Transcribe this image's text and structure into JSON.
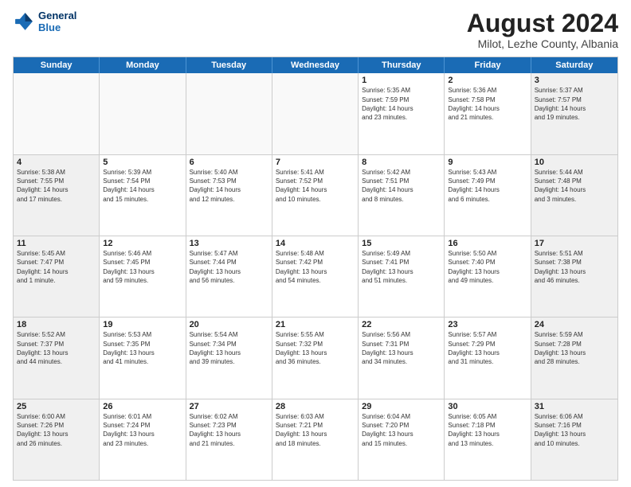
{
  "header": {
    "logo_line1": "General",
    "logo_line2": "Blue",
    "month_year": "August 2024",
    "location": "Milot, Lezhe County, Albania"
  },
  "weekdays": [
    "Sunday",
    "Monday",
    "Tuesday",
    "Wednesday",
    "Thursday",
    "Friday",
    "Saturday"
  ],
  "rows": [
    [
      {
        "day": "",
        "empty": true,
        "lines": []
      },
      {
        "day": "",
        "empty": true,
        "lines": []
      },
      {
        "day": "",
        "empty": true,
        "lines": []
      },
      {
        "day": "",
        "empty": true,
        "lines": []
      },
      {
        "day": "1",
        "lines": [
          "Sunrise: 5:35 AM",
          "Sunset: 7:59 PM",
          "Daylight: 14 hours",
          "and 23 minutes."
        ]
      },
      {
        "day": "2",
        "lines": [
          "Sunrise: 5:36 AM",
          "Sunset: 7:58 PM",
          "Daylight: 14 hours",
          "and 21 minutes."
        ]
      },
      {
        "day": "3",
        "shaded": true,
        "lines": [
          "Sunrise: 5:37 AM",
          "Sunset: 7:57 PM",
          "Daylight: 14 hours",
          "and 19 minutes."
        ]
      }
    ],
    [
      {
        "day": "4",
        "shaded": true,
        "lines": [
          "Sunrise: 5:38 AM",
          "Sunset: 7:55 PM",
          "Daylight: 14 hours",
          "and 17 minutes."
        ]
      },
      {
        "day": "5",
        "lines": [
          "Sunrise: 5:39 AM",
          "Sunset: 7:54 PM",
          "Daylight: 14 hours",
          "and 15 minutes."
        ]
      },
      {
        "day": "6",
        "lines": [
          "Sunrise: 5:40 AM",
          "Sunset: 7:53 PM",
          "Daylight: 14 hours",
          "and 12 minutes."
        ]
      },
      {
        "day": "7",
        "lines": [
          "Sunrise: 5:41 AM",
          "Sunset: 7:52 PM",
          "Daylight: 14 hours",
          "and 10 minutes."
        ]
      },
      {
        "day": "8",
        "lines": [
          "Sunrise: 5:42 AM",
          "Sunset: 7:51 PM",
          "Daylight: 14 hours",
          "and 8 minutes."
        ]
      },
      {
        "day": "9",
        "lines": [
          "Sunrise: 5:43 AM",
          "Sunset: 7:49 PM",
          "Daylight: 14 hours",
          "and 6 minutes."
        ]
      },
      {
        "day": "10",
        "shaded": true,
        "lines": [
          "Sunrise: 5:44 AM",
          "Sunset: 7:48 PM",
          "Daylight: 14 hours",
          "and 3 minutes."
        ]
      }
    ],
    [
      {
        "day": "11",
        "shaded": true,
        "lines": [
          "Sunrise: 5:45 AM",
          "Sunset: 7:47 PM",
          "Daylight: 14 hours",
          "and 1 minute."
        ]
      },
      {
        "day": "12",
        "lines": [
          "Sunrise: 5:46 AM",
          "Sunset: 7:45 PM",
          "Daylight: 13 hours",
          "and 59 minutes."
        ]
      },
      {
        "day": "13",
        "lines": [
          "Sunrise: 5:47 AM",
          "Sunset: 7:44 PM",
          "Daylight: 13 hours",
          "and 56 minutes."
        ]
      },
      {
        "day": "14",
        "lines": [
          "Sunrise: 5:48 AM",
          "Sunset: 7:42 PM",
          "Daylight: 13 hours",
          "and 54 minutes."
        ]
      },
      {
        "day": "15",
        "lines": [
          "Sunrise: 5:49 AM",
          "Sunset: 7:41 PM",
          "Daylight: 13 hours",
          "and 51 minutes."
        ]
      },
      {
        "day": "16",
        "lines": [
          "Sunrise: 5:50 AM",
          "Sunset: 7:40 PM",
          "Daylight: 13 hours",
          "and 49 minutes."
        ]
      },
      {
        "day": "17",
        "shaded": true,
        "lines": [
          "Sunrise: 5:51 AM",
          "Sunset: 7:38 PM",
          "Daylight: 13 hours",
          "and 46 minutes."
        ]
      }
    ],
    [
      {
        "day": "18",
        "shaded": true,
        "lines": [
          "Sunrise: 5:52 AM",
          "Sunset: 7:37 PM",
          "Daylight: 13 hours",
          "and 44 minutes."
        ]
      },
      {
        "day": "19",
        "lines": [
          "Sunrise: 5:53 AM",
          "Sunset: 7:35 PM",
          "Daylight: 13 hours",
          "and 41 minutes."
        ]
      },
      {
        "day": "20",
        "lines": [
          "Sunrise: 5:54 AM",
          "Sunset: 7:34 PM",
          "Daylight: 13 hours",
          "and 39 minutes."
        ]
      },
      {
        "day": "21",
        "lines": [
          "Sunrise: 5:55 AM",
          "Sunset: 7:32 PM",
          "Daylight: 13 hours",
          "and 36 minutes."
        ]
      },
      {
        "day": "22",
        "lines": [
          "Sunrise: 5:56 AM",
          "Sunset: 7:31 PM",
          "Daylight: 13 hours",
          "and 34 minutes."
        ]
      },
      {
        "day": "23",
        "lines": [
          "Sunrise: 5:57 AM",
          "Sunset: 7:29 PM",
          "Daylight: 13 hours",
          "and 31 minutes."
        ]
      },
      {
        "day": "24",
        "shaded": true,
        "lines": [
          "Sunrise: 5:59 AM",
          "Sunset: 7:28 PM",
          "Daylight: 13 hours",
          "and 28 minutes."
        ]
      }
    ],
    [
      {
        "day": "25",
        "shaded": true,
        "lines": [
          "Sunrise: 6:00 AM",
          "Sunset: 7:26 PM",
          "Daylight: 13 hours",
          "and 26 minutes."
        ]
      },
      {
        "day": "26",
        "lines": [
          "Sunrise: 6:01 AM",
          "Sunset: 7:24 PM",
          "Daylight: 13 hours",
          "and 23 minutes."
        ]
      },
      {
        "day": "27",
        "lines": [
          "Sunrise: 6:02 AM",
          "Sunset: 7:23 PM",
          "Daylight: 13 hours",
          "and 21 minutes."
        ]
      },
      {
        "day": "28",
        "lines": [
          "Sunrise: 6:03 AM",
          "Sunset: 7:21 PM",
          "Daylight: 13 hours",
          "and 18 minutes."
        ]
      },
      {
        "day": "29",
        "lines": [
          "Sunrise: 6:04 AM",
          "Sunset: 7:20 PM",
          "Daylight: 13 hours",
          "and 15 minutes."
        ]
      },
      {
        "day": "30",
        "lines": [
          "Sunrise: 6:05 AM",
          "Sunset: 7:18 PM",
          "Daylight: 13 hours",
          "and 13 minutes."
        ]
      },
      {
        "day": "31",
        "shaded": true,
        "lines": [
          "Sunrise: 6:06 AM",
          "Sunset: 7:16 PM",
          "Daylight: 13 hours",
          "and 10 minutes."
        ]
      }
    ]
  ]
}
